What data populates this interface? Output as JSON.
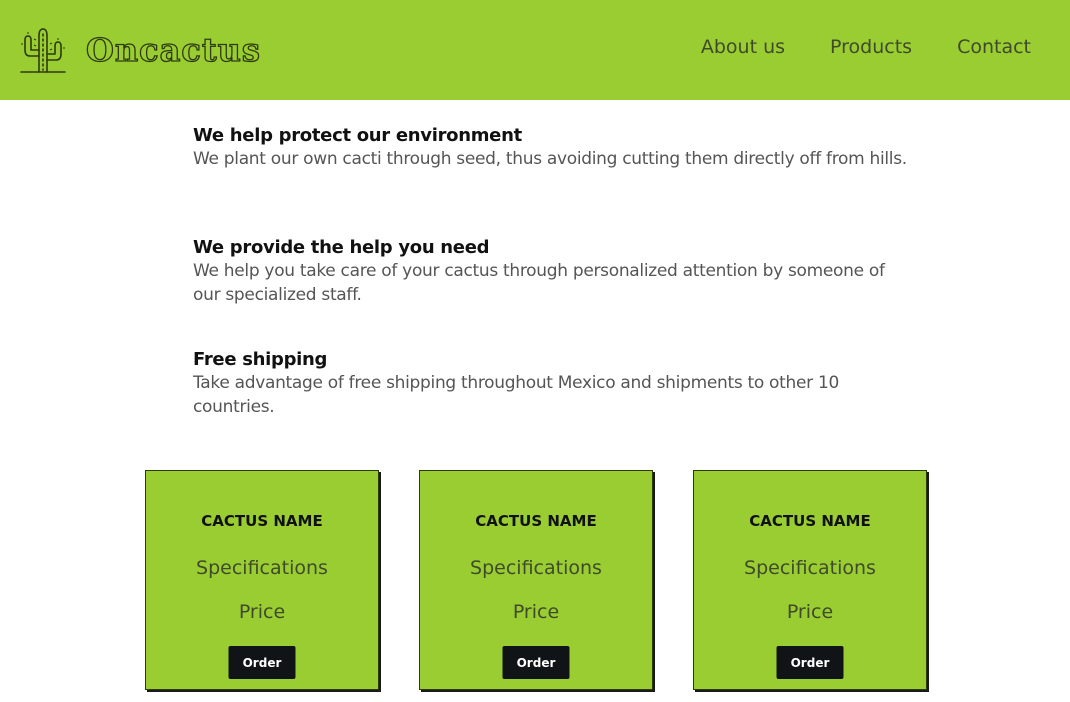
{
  "header": {
    "logo_icon": "cactus-icon",
    "brand": "Oncactus",
    "background_color": "#9acd32",
    "nav": [
      {
        "label": "About us"
      },
      {
        "label": "Products"
      },
      {
        "label": "Contact"
      }
    ]
  },
  "features": [
    {
      "title": "We help protect our environment",
      "text": "We plant our own cacti through seed, thus avoiding cutting them directly off from hills."
    },
    {
      "title": "We provide the help you need",
      "text": "We help you take care of your cactus through personalized attention by someone of our specialized staff."
    },
    {
      "title": "Free shipping",
      "text": "Take advantage of free shipping throughout Mexico and shipments to other 10 countries."
    }
  ],
  "products": [
    {
      "name": "CACTUS NAME",
      "specs": "Specifications",
      "price": "Price",
      "button": "Order"
    },
    {
      "name": "CACTUS NAME",
      "specs": "Specifications",
      "price": "Price",
      "button": "Order"
    },
    {
      "name": "CACTUS NAME",
      "specs": "Specifications",
      "price": "Price",
      "button": "Order"
    }
  ]
}
